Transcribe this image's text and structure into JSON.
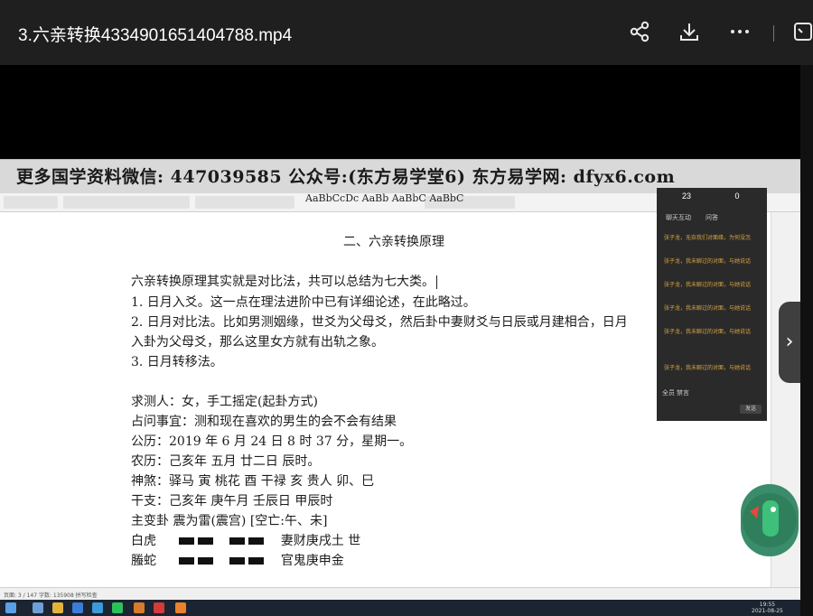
{
  "window": {
    "title": "3.六亲转换4334901651404788.mp4",
    "actions": [
      {
        "name": "share-icon",
        "glyph": "⇅"
      },
      {
        "name": "download-icon",
        "glyph": "⤓"
      },
      {
        "name": "more-icon",
        "glyph": "⋯"
      },
      {
        "name": "exit-fullscreen-icon",
        "glyph": "⧉"
      }
    ]
  },
  "banner": {
    "text": "更多国学资料微信: 447039585 公众号:(东方易学堂6) 东方易学网: dfyx6.com"
  },
  "ribbon": {
    "styles_preview": "AaBbCcDc  AaBb AaBbC AaBbC"
  },
  "document": {
    "title": "二、六亲转换原理",
    "lines": [
      "六亲转换原理其实就是对比法，共可以总结为七大类。",
      "1. 日月入爻。这一点在理法进阶中已有详细论述，在此略过。",
      "2. 日月对比法。比如男测姻缘，世爻为父母爻，然后卦中妻财爻与日辰或月建相合，日月",
      "入卦为父母爻，那么这里女方就有出轨之象。",
      "3. 日月转移法。",
      "",
      "求测人：女，手工摇定(起卦方式)",
      "占问事宜：测和现在喜欢的男生的会不会有结果",
      "公历：2019 年 6 月 24 日 8 时 37 分，星期一。",
      "农历：己亥年  五月  廿二日  辰时。",
      "神煞：驿马  寅   桃花  酉   干禄  亥   贵人  卯、巳",
      "干支：己亥年      庚午月      壬辰日      甲辰时",
      "主变卦             震为雷(震宫)      [空亡:午、未]"
    ],
    "yao_rows": [
      {
        "label": "白虎",
        "text": "妻财庚戌土   世"
      },
      {
        "label": "螣蛇",
        "text": "官鬼庚申金"
      }
    ]
  },
  "chat": {
    "stats": [
      "23",
      "0"
    ],
    "tabs": [
      "聊天互动",
      "问答"
    ],
    "messages": [
      "张子龙，无奈我们对面缘，为何没怎",
      "张子龙，我未聊过的对面，与她说话",
      "张子龙，我未聊过的对面，与她说话",
      "张子龙，我未聊过的对面，与她说话",
      "张子龙，我未聊过的对面，与她说话",
      "张子龙，我未聊过的对面，与她说话"
    ],
    "footer": "全员   禁言",
    "send": "发送"
  },
  "statusbar": {
    "text": "页面: 3 / 147   字数: 135908   拼写检查"
  },
  "clock": {
    "time": "19:55",
    "date": "2021-08-25"
  }
}
